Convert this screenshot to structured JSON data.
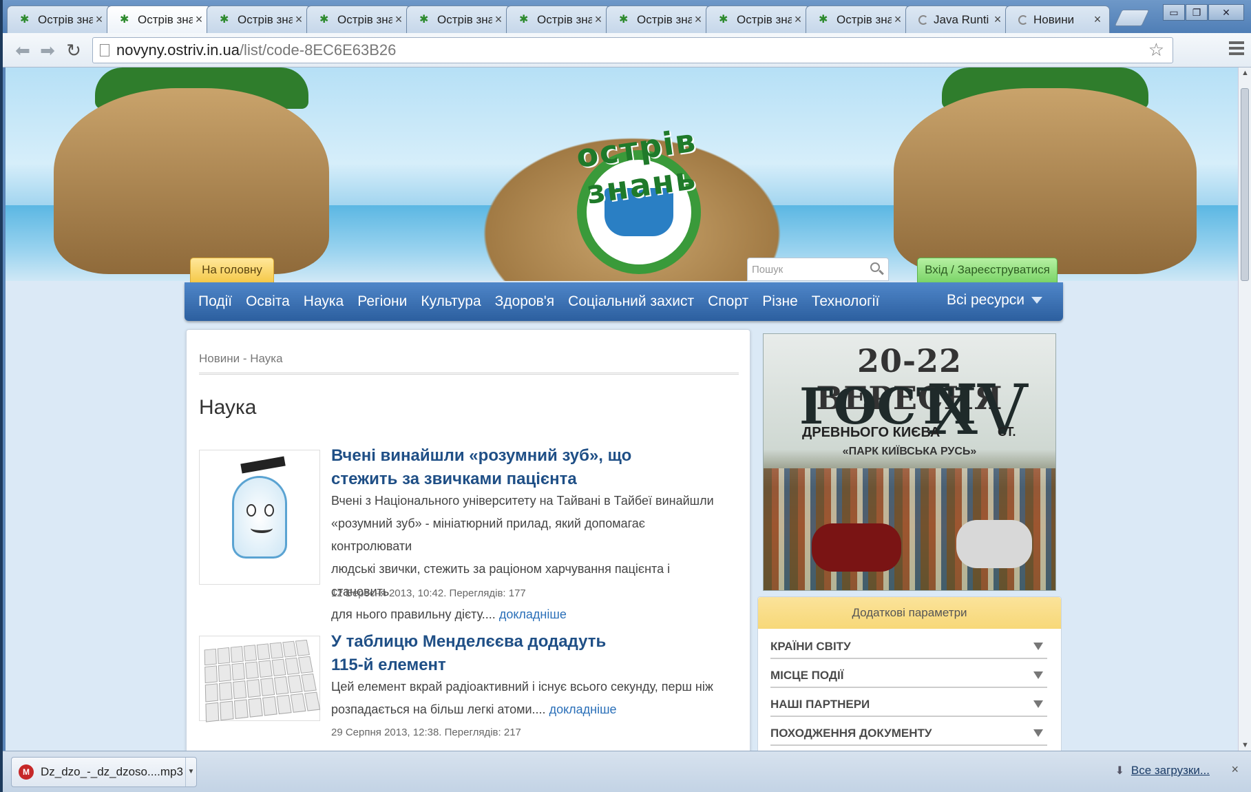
{
  "tabs": [
    {
      "title": "Острів зна",
      "close": "×",
      "icon": "palm-tree-icon"
    },
    {
      "title": "Острів зна",
      "close": "×",
      "icon": "palm-tree-icon",
      "active": true
    },
    {
      "title": "Острів зна",
      "close": "×",
      "icon": "palm-tree-icon"
    },
    {
      "title": "Острів зна",
      "close": "×",
      "icon": "palm-tree-icon"
    },
    {
      "title": "Острів зна",
      "close": "×",
      "icon": "palm-tree-icon"
    },
    {
      "title": "Острів зна",
      "close": "×",
      "icon": "palm-tree-icon"
    },
    {
      "title": "Острів зна",
      "close": "×",
      "icon": "palm-tree-icon"
    },
    {
      "title": "Острів зна",
      "close": "×",
      "icon": "palm-tree-icon"
    },
    {
      "title": "Острів зна",
      "close": "×",
      "icon": "palm-tree-icon"
    },
    {
      "title": "Java Runti",
      "close": "×",
      "icon": "loading-icon"
    },
    {
      "title": "Новини",
      "close": "×",
      "icon": "loading-icon"
    }
  ],
  "toolbar": {
    "url_host": "novyny.ostriv.in.ua",
    "url_path": "/list/code-8EC6E63B26"
  },
  "header": {
    "logo_text": "острів знань",
    "home_label": "На головну",
    "search_placeholder": "Пошук",
    "login_label": "Вхід / Зареєструватися"
  },
  "nav": {
    "items": [
      "Події",
      "Освіта",
      "Наука",
      "Регіони",
      "Культура",
      "Здоров'я",
      "Соціальний захист",
      "Спорт",
      "Різне",
      "Технології"
    ],
    "all_resources": "Всі ресурси"
  },
  "main": {
    "breadcrumb": "Новини - Наука",
    "title": "Наука",
    "articles": [
      {
        "title_line1": "Вчені винайшли «розумний зуб», що",
        "title_line2": "стежить за звичками пацієнта",
        "text_lines": [
          "Вчені з Національного університету на Тайвані в Тайбеї винайшли",
          "«розумний зуб» - мініатюрний прилад, який допомагає контролювати",
          "людські звички, стежить за раціоном харчування пацієнта і становить",
          "для нього правильну дієту...."
        ],
        "more": "докладніше",
        "meta": "12 Вересня 2013, 10:42. Переглядів: 177"
      },
      {
        "title_line1": "У таблицю Менделєєва додадуть",
        "title_line2": "115-й елемент",
        "text_lines": [
          "Цей елемент вкрай радіоактивний і існує всього секунду, перш ніж",
          "розпадається на більш легкі атоми...."
        ],
        "more": "докладніше",
        "meta": "29 Серпня 2013, 12:38. Переглядів: 217"
      }
    ]
  },
  "banner": {
    "dates": "20-22 ВЕРЕСНЯ",
    "guests": "ГОСТІ",
    "century_roman": "XV",
    "century_suffix": "СТ.",
    "kyiv": "ДРЕВНЬОГО КИЄВА",
    "park": "«ПАРК КИЇВСЬКА РУСЬ»"
  },
  "params": {
    "header": "Додаткові параметри",
    "rows": [
      "КРАЇНИ СВІТУ",
      "МІСЦЕ ПОДІЇ",
      "НАШІ ПАРТНЕРИ",
      "ПОХОДЖЕННЯ ДОКУМЕНТУ"
    ]
  },
  "downloads": {
    "file": "Dz_dzo_-_dz_dzoso....mp3",
    "all_label": "Все загрузки...",
    "close": "×"
  }
}
